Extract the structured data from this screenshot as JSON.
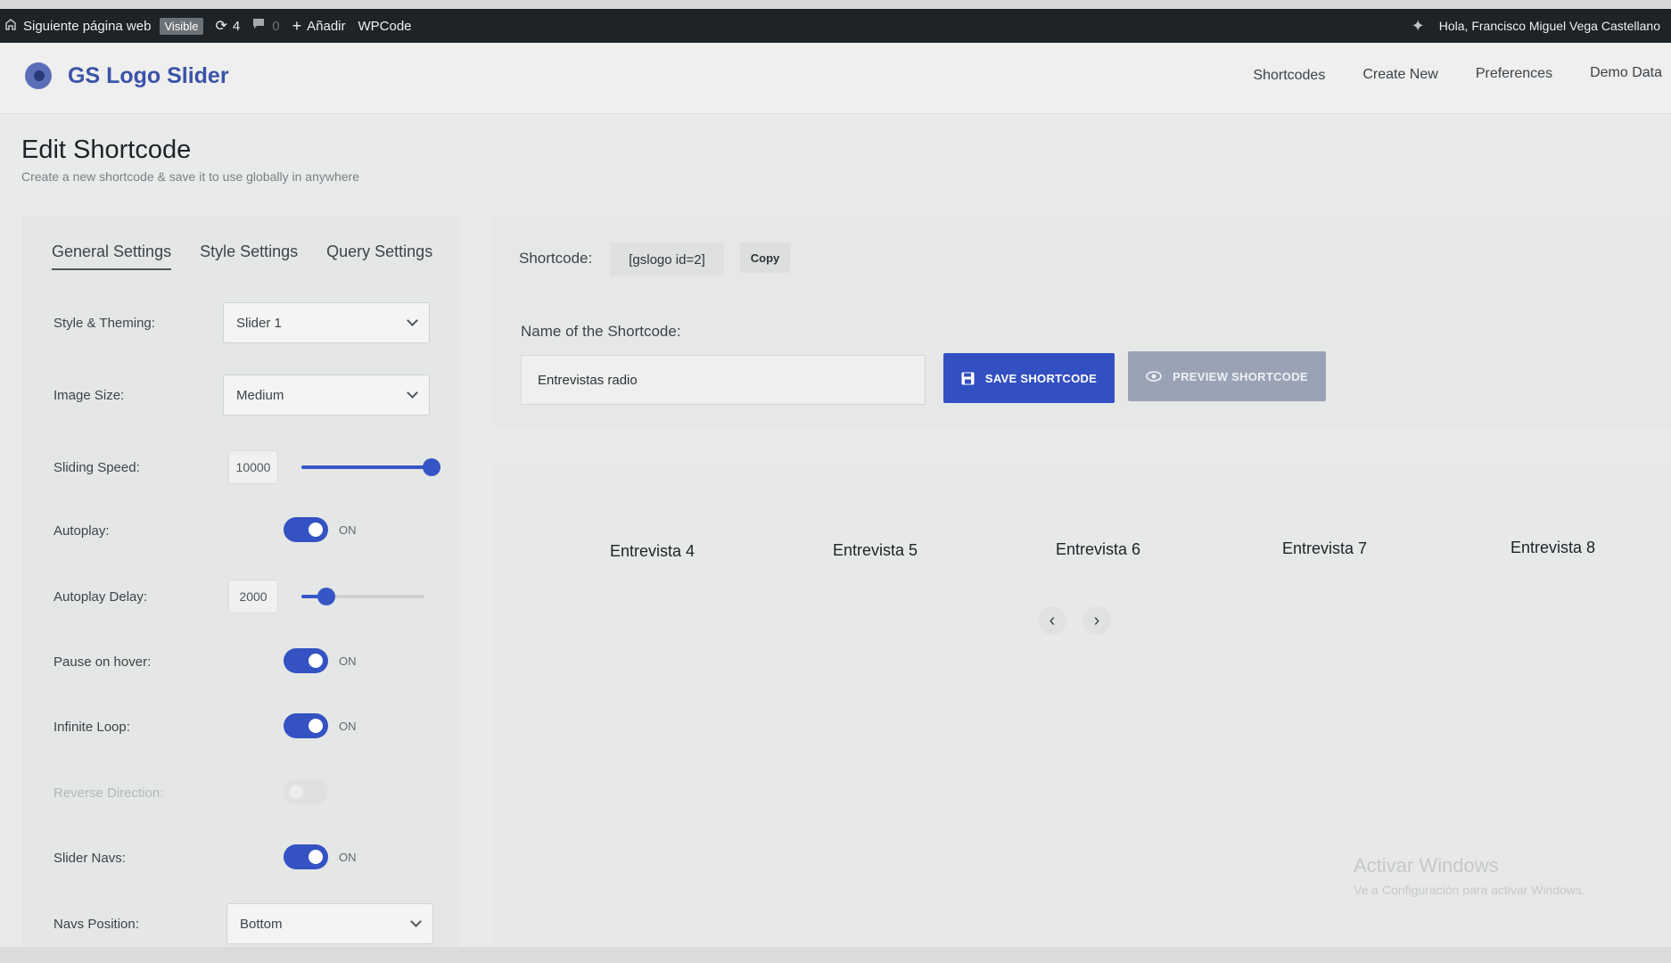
{
  "adminbar": {
    "site_label": "Siguiente página web",
    "visible_badge": "Visible",
    "updates_count": "4",
    "comments_count": "0",
    "add_label": "Añadir",
    "wpcode_label": "WPCode",
    "greeting": "Hola, Francisco Miguel Vega Castellano"
  },
  "plugin": {
    "name": "GS Logo Slider",
    "nav": [
      "Shortcodes",
      "Create New",
      "Preferences",
      "Demo Data"
    ]
  },
  "page": {
    "title": "Edit Shortcode",
    "subtitle": "Create a new shortcode & save it to use globally in anywhere"
  },
  "settings": {
    "tabs": [
      "General Settings",
      "Style Settings",
      "Query Settings"
    ],
    "style_theming": {
      "label": "Style & Theming:",
      "value": "Slider 1"
    },
    "image_size": {
      "label": "Image Size:",
      "value": "Medium"
    },
    "sliding_speed": {
      "label": "Sliding Speed:",
      "value": "10000",
      "level": 1.0
    },
    "autoplay": {
      "label": "Autoplay:",
      "state": "ON"
    },
    "autoplay_delay": {
      "label": "Autoplay Delay:",
      "value": "2000",
      "level": 0.2
    },
    "pause_on_hover": {
      "label": "Pause on hover:",
      "state": "ON"
    },
    "infinite_loop": {
      "label": "Infinite Loop:",
      "state": "ON"
    },
    "reverse_direction": {
      "label": "Reverse Direction:"
    },
    "slider_navs": {
      "label": "Slider Navs:",
      "state": "ON"
    },
    "navs_position": {
      "label": "Navs Position:",
      "value": "Bottom"
    }
  },
  "shortcode": {
    "label": "Shortcode:",
    "code": "[gslogo id=2]",
    "copy_label": "Copy",
    "name_label": "Name of the Shortcode:",
    "name_value": "Entrevistas radio",
    "save_label": "SAVE SHORTCODE",
    "preview_label": "PREVIEW SHORTCODE"
  },
  "preview": {
    "items": [
      "Entrevista 4",
      "Entrevista 5",
      "Entrevista 6",
      "Entrevista 7",
      "Entrevista 8"
    ],
    "prev": "‹",
    "next": "›"
  },
  "watermark": {
    "line1": "Activar Windows",
    "line2": "Ve a Configuración para activar Windows."
  },
  "colors": {
    "accent": "#3350c2",
    "adminbar": "#1d2327",
    "brand": "#3b53a8"
  }
}
